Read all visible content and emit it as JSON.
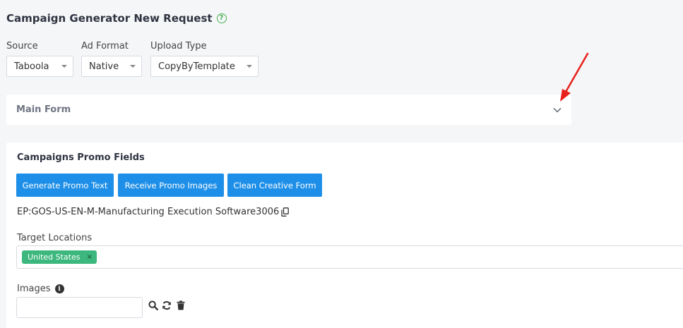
{
  "page": {
    "title": "Campaign Generator New Request",
    "help_icon": "question-circle-icon"
  },
  "filters": {
    "source": {
      "label": "Source",
      "value": "Taboola"
    },
    "ad_format": {
      "label": "Ad Format",
      "value": "Native"
    },
    "upload_type": {
      "label": "Upload Type",
      "value": "CopyByTemplate"
    }
  },
  "main_form": {
    "title": "Main Form",
    "expand_icon": "chevron-down-icon"
  },
  "annotation": {
    "icon": "red-arrow-icon",
    "color": "#e8211a"
  },
  "promo": {
    "title": "Campaigns Promo Fields",
    "buttons": {
      "generate": "Generate Promo Text",
      "receive": "Receive Promo Images",
      "clean": "Clean Creative Form"
    },
    "ep_code": "EP:GOS-US-EN-M-Manufacturing Execution Software3006",
    "target_locations": {
      "label": "Target Locations",
      "tags": [
        {
          "text": "United States",
          "remove": "×"
        }
      ]
    },
    "images": {
      "label": "Images",
      "info": "i",
      "input_value": "",
      "icons": [
        "search-icon",
        "refresh-icon",
        "trash-icon"
      ]
    }
  },
  "colors": {
    "accent": "#1e8fe8",
    "tag": "#3cb77d",
    "help": "#4caf50"
  }
}
